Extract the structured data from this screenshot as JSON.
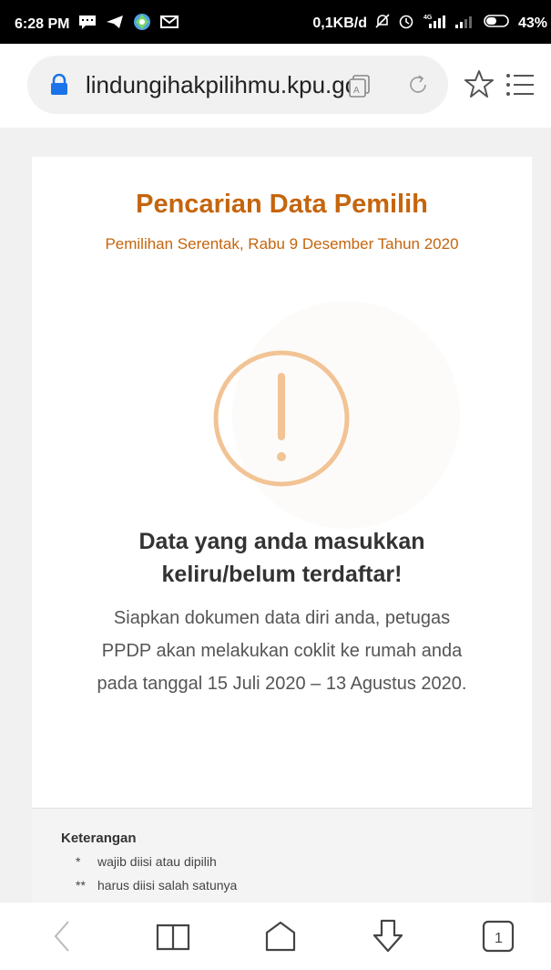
{
  "status_bar": {
    "time": "6:28 PM",
    "net_speed": "0,1KB/d",
    "battery": "43%",
    "icons": [
      "chat-icon",
      "telegram-icon",
      "app-icon",
      "gmail-icon",
      "silent-icon",
      "alarm-icon",
      "signal-4g-icon",
      "signal-icon",
      "battery-icon"
    ]
  },
  "browser": {
    "url": "lindungihakpilihmu.kpu.go.id",
    "icons": [
      "lock-icon",
      "reader-mode-icon",
      "reload-icon",
      "star-icon",
      "menu-icon"
    ]
  },
  "page": {
    "title": "Pencarian Data Pemilih",
    "subtitle": "Pemilihan Serentak, Rabu 9 Desember Tahun 2020",
    "alert_title_line1": "Data yang anda masukkan",
    "alert_title_line2": "keliru/belum terdaftar!",
    "alert_message_line1": "Siapkan dokumen data diri anda, petugas",
    "alert_message_line2": "PPDP akan melakukan coklit ke rumah anda",
    "alert_message_line3": "pada tanggal 15 Juli 2020 – 13 Agustus 2020.",
    "accent_color": "#c5650d",
    "warning_color": "#f2c394"
  },
  "footer": {
    "heading": "Keterangan",
    "notes": [
      {
        "mark": "*",
        "text": "wajib diisi atau dipilih"
      },
      {
        "mark": "**",
        "text": "harus diisi salah satunya"
      }
    ]
  },
  "nav_bar": {
    "tab_count": "1",
    "icons": [
      "back-icon",
      "bookmarks-icon",
      "home-icon",
      "download-icon",
      "tabs-icon"
    ]
  }
}
